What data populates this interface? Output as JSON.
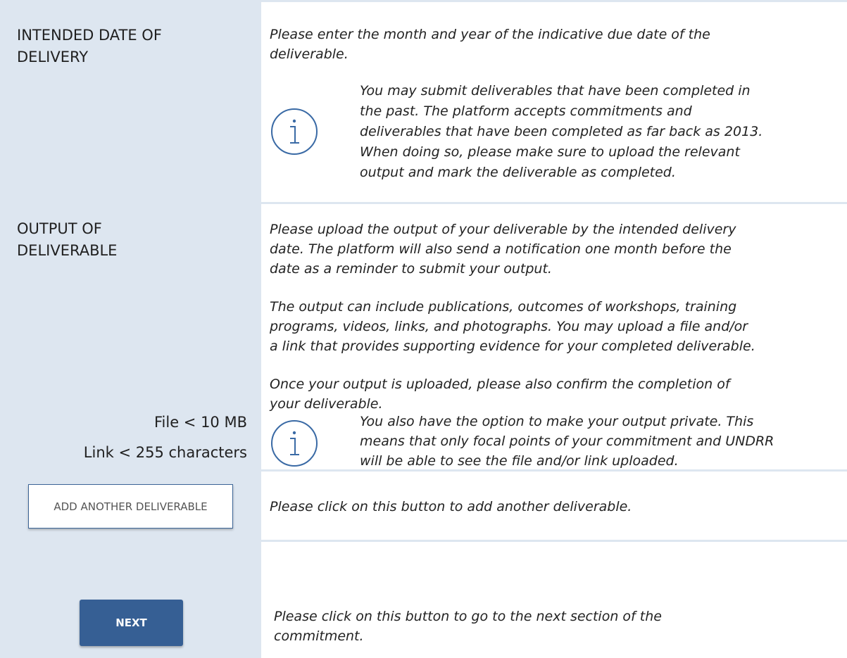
{
  "rows": {
    "delivery_date": {
      "label_line1": "INTENDED DATE OF",
      "label_line2": "DELIVERY",
      "instruction_line1": "Please enter the month and year of the indicative due date of the",
      "instruction_line2": "deliverable.",
      "info_lines": [
        "You may submit deliverables that have been completed in",
        "the past. The platform accepts commitments and",
        "deliverables that have been completed as far back as 2013.",
        "When doing so, please make sure to upload the relevant",
        "output and mark the deliverable as completed."
      ]
    },
    "output": {
      "label_line1": "OUTPUT OF",
      "label_line2": "DELIVERABLE",
      "file_limit": "File < 10 MB",
      "link_limit": "Link < 255 characters",
      "para1_lines": [
        "Please upload the output of your deliverable by the intended delivery",
        "date. The platform will also send a notification one month before the",
        "date as a reminder to submit your output."
      ],
      "para2_lines": [
        "The output can include publications, outcomes of workshops, training",
        "programs, videos, links, and photographs. You may upload a file and/or",
        "a link that provides supporting evidence for your completed deliverable."
      ],
      "para3_lines": [
        "Once your output is uploaded, please also confirm the completion of",
        "your deliverable."
      ],
      "info_lines": [
        "You also have the option to make your output private. This",
        "means that only focal points of your commitment and UNDRR",
        "will be able to see the file and/or link uploaded."
      ]
    },
    "add_deliverable": {
      "button_label": "ADD ANOTHER DELIVERABLE",
      "description": "Please click on this button to add another deliverable."
    },
    "next": {
      "button_label": "NEXT",
      "description_line1": "Please click on this button to go to the next section of the",
      "description_line2": "commitment."
    }
  },
  "colors": {
    "label_background": "#dde6f0",
    "accent": "#365f94",
    "info_icon": "#3a6aa5"
  },
  "icons": [
    "info-icon",
    "info-icon"
  ]
}
